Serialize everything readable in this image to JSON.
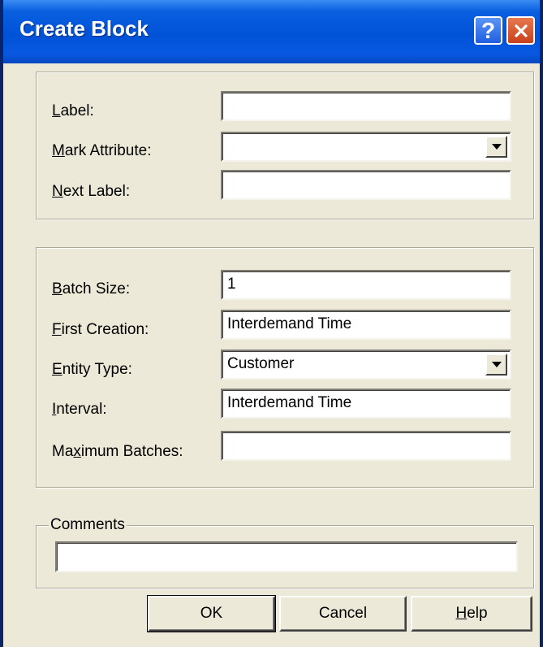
{
  "window": {
    "title": "Create Block",
    "help_glyph": "?",
    "close_icon": "close-icon"
  },
  "group1": {
    "label": {
      "prefix": "",
      "key": "L",
      "rest": "abel:",
      "value": ""
    },
    "mark_attribute": {
      "prefix": "",
      "key": "M",
      "rest": "ark Attribute:",
      "value": ""
    },
    "next_label": {
      "prefix": "",
      "key": "N",
      "rest": "ext Label:",
      "value": ""
    }
  },
  "group2": {
    "batch_size": {
      "prefix": "",
      "key": "B",
      "rest": "atch Size:",
      "value": "1"
    },
    "first_creation": {
      "prefix": "",
      "key": "F",
      "rest": "irst Creation:",
      "value": "Interdemand Time"
    },
    "entity_type": {
      "prefix": "",
      "key": "E",
      "rest": "ntity Type:",
      "value": "Customer"
    },
    "interval": {
      "prefix": "",
      "key": "I",
      "rest": "nterval:",
      "value": "Interdemand Time"
    },
    "maximum_batches": {
      "prefix": "Ma",
      "key": "x",
      "rest": "imum Batches:",
      "value": ""
    }
  },
  "comments": {
    "caption": "Comments",
    "value": ""
  },
  "buttons": {
    "ok": "OK",
    "cancel": "Cancel",
    "help": {
      "key": "H",
      "rest": "elp"
    }
  },
  "colors": {
    "titlebar": "#0052d6",
    "face": "#ece9d8",
    "close": "#c7411b"
  }
}
